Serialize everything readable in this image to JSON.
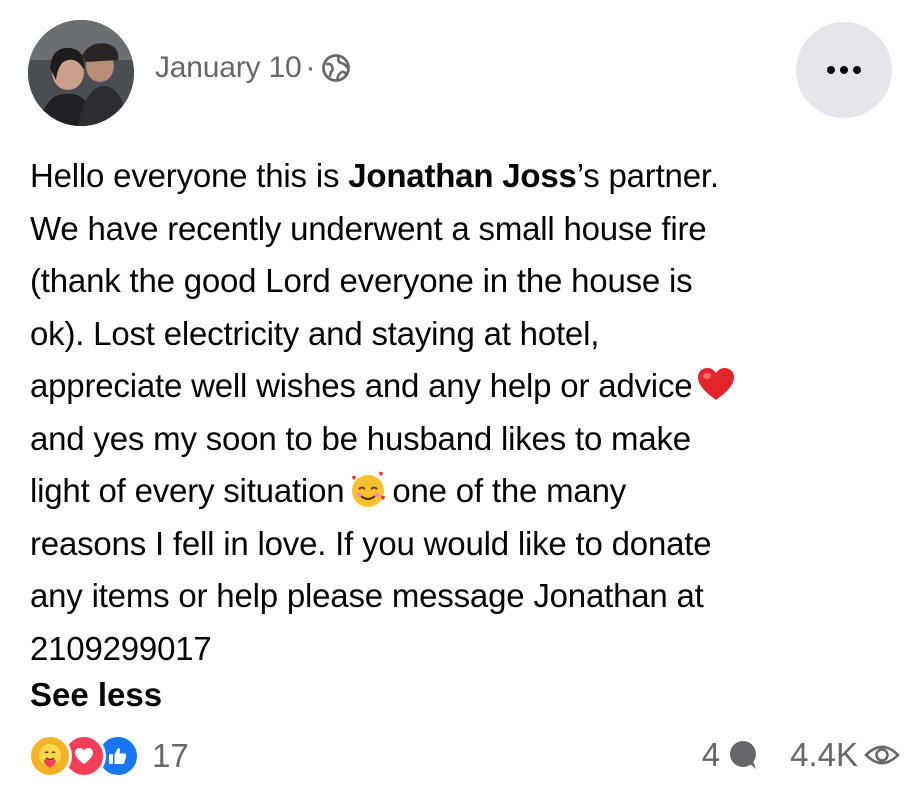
{
  "post": {
    "date": "January 10",
    "separator": "·",
    "privacy_icon": "globe-icon",
    "more_icon": "more-options-icon",
    "body_lines": [
      {
        "before": "Hello everyone this is ",
        "bold": "Jonathan Joss",
        "after": "’s partner."
      },
      {
        "text": "We have recently underwent a small house fire"
      },
      {
        "text": "(thank the good Lord everyone in the house is"
      },
      {
        "text": "ok). Lost electricity and staying at hotel,"
      },
      {
        "text": "appreciate well wishes and any help or advice"
      },
      {
        "text": "and yes my soon to be husband likes to make"
      },
      {
        "text_before": "light of every situation",
        "text_after": "one of the many"
      },
      {
        "text": "reasons I fell in love. If you would like to donate"
      },
      {
        "text": "any items or help please message Jonathan at"
      },
      {
        "text": "2109299017"
      }
    ],
    "emojis": {
      "heart": "red-heart-emoji",
      "love_face": "smiling-face-with-hearts-emoji"
    },
    "see_less": "See less"
  },
  "footer": {
    "reaction_icons": [
      "care-reaction-icon",
      "love-reaction-icon",
      "like-reaction-icon"
    ],
    "reaction_count": "17",
    "comment_count": "4",
    "view_count": "4.4K"
  },
  "colors": {
    "secondary_text": "#65676b",
    "like_blue": "#1877f2",
    "love_red": "#f33e58",
    "care_yellow": "#f7b125",
    "button_gray": "#e4e6eb"
  }
}
